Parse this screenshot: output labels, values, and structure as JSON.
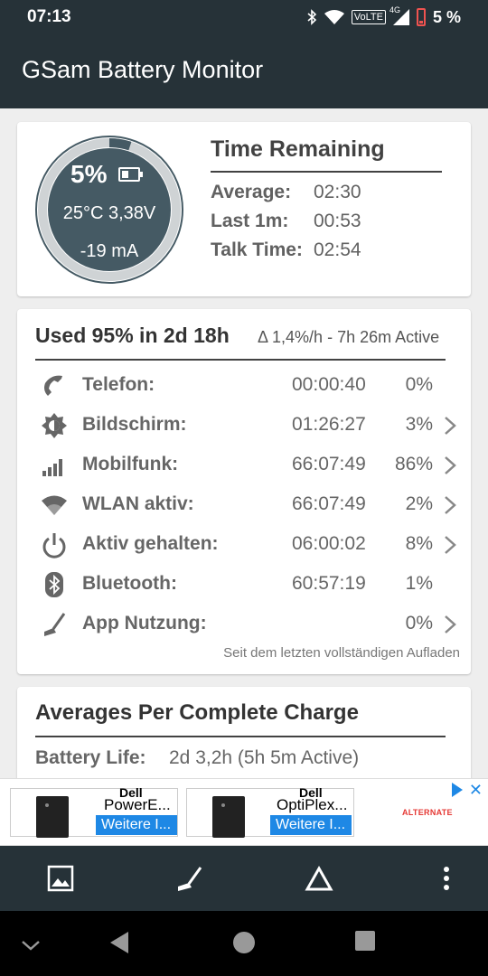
{
  "status_bar": {
    "time": "07:13",
    "network": "VoLTE",
    "network_type": "4G",
    "battery_percent": "5 %"
  },
  "app_bar": {
    "title": "GSam Battery Monitor"
  },
  "gauge": {
    "level": 0.05,
    "percent": "5%",
    "temp_voltage": "25°C  3,38V",
    "current": "-19 mA"
  },
  "time_remaining": {
    "title": "Time Remaining",
    "rows": [
      {
        "label": "Average:",
        "value": "02:30"
      },
      {
        "label": "Last 1m:",
        "value": "00:53"
      },
      {
        "label": "Talk Time:",
        "value": "02:54"
      }
    ]
  },
  "usage": {
    "title": "Used 95% in 2d 18h",
    "rate": "Δ 1,4%/h - 7h 26m Active",
    "rows": [
      {
        "icon": "phone-icon",
        "label": "Telefon:",
        "duration": "00:00:40",
        "percent": "0%",
        "chevron": false
      },
      {
        "icon": "brightness-icon",
        "label": "Bildschirm:",
        "duration": "01:26:27",
        "percent": "3%",
        "chevron": true
      },
      {
        "icon": "signal-bars-icon",
        "label": "Mobilfunk:",
        "duration": "66:07:49",
        "percent": "86%",
        "chevron": true
      },
      {
        "icon": "wifi-icon",
        "label": "WLAN aktiv:",
        "duration": "66:07:49",
        "percent": "2%",
        "chevron": true
      },
      {
        "icon": "power-icon",
        "label": "Aktiv gehalten:",
        "duration": "06:00:02",
        "percent": "8%",
        "chevron": true
      },
      {
        "icon": "bluetooth-icon",
        "label": "Bluetooth:",
        "duration": "60:57:19",
        "percent": "1%",
        "chevron": false
      },
      {
        "icon": "broom-icon",
        "label": "App Nutzung:",
        "duration": "",
        "percent": "0%",
        "chevron": true
      }
    ],
    "footnote": "Seit dem letzten vollständigen Aufladen"
  },
  "averages": {
    "title": "Averages Per Complete Charge",
    "battery_life_label": "Battery Life:",
    "battery_life_value": "2d 3,2h (5h 5m Active)"
  },
  "ad": {
    "items": [
      {
        "brand": "Dell",
        "name": "PowerE...",
        "button": "Weitere I..."
      },
      {
        "brand": "Dell",
        "name": "OptiPlex...",
        "button": "Weitere I..."
      }
    ],
    "advertiser": "ALTERNATE"
  },
  "bottom_bar": {
    "icons": [
      "image-icon",
      "broom-icon",
      "delta-icon",
      "more-vert-icon"
    ]
  },
  "nav_bar": {
    "icons": [
      "chevron-down-icon",
      "back-icon",
      "home-icon",
      "recents-icon"
    ]
  },
  "colors": {
    "primary_dark": "#263238",
    "gauge_fill": "#455a64",
    "link_blue": "#1e88e5",
    "ad_red": "#e53935"
  }
}
